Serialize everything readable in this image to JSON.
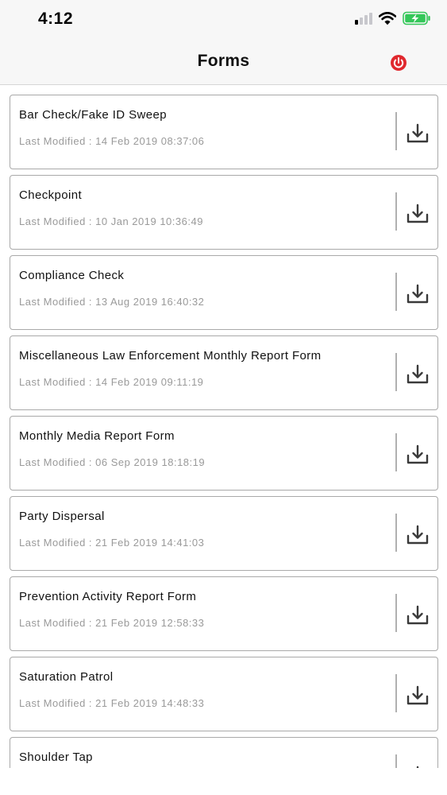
{
  "status_bar": {
    "time": "4:12",
    "icons": [
      "signal-icon",
      "wifi-icon",
      "battery-charging-icon"
    ],
    "battery_color": "#34c759"
  },
  "nav": {
    "title": "Forms",
    "power_icon": "power-icon",
    "power_color": "#e0282e"
  },
  "forms": [
    {
      "title": "Bar Check/Fake ID Sweep",
      "modified": "Last Modified : 14 Feb 2019 08:37:06"
    },
    {
      "title": "Checkpoint",
      "modified": "Last Modified : 10 Jan 2019 10:36:49"
    },
    {
      "title": "Compliance Check",
      "modified": "Last Modified : 13 Aug 2019 16:40:32"
    },
    {
      "title": "Miscellaneous Law Enforcement Monthly Report Form",
      "modified": "Last Modified : 14 Feb 2019 09:11:19"
    },
    {
      "title": "Monthly Media Report Form",
      "modified": "Last Modified : 06 Sep 2019 18:18:19"
    },
    {
      "title": "Party Dispersal",
      "modified": "Last Modified : 21 Feb 2019 14:41:03"
    },
    {
      "title": "Prevention Activity Report Form",
      "modified": "Last Modified : 21 Feb 2019 12:58:33"
    },
    {
      "title": "Saturation Patrol",
      "modified": "Last Modified : 21 Feb 2019 14:48:33"
    },
    {
      "title": "Shoulder Tap",
      "modified": ""
    }
  ],
  "download_icon": "download-icon"
}
